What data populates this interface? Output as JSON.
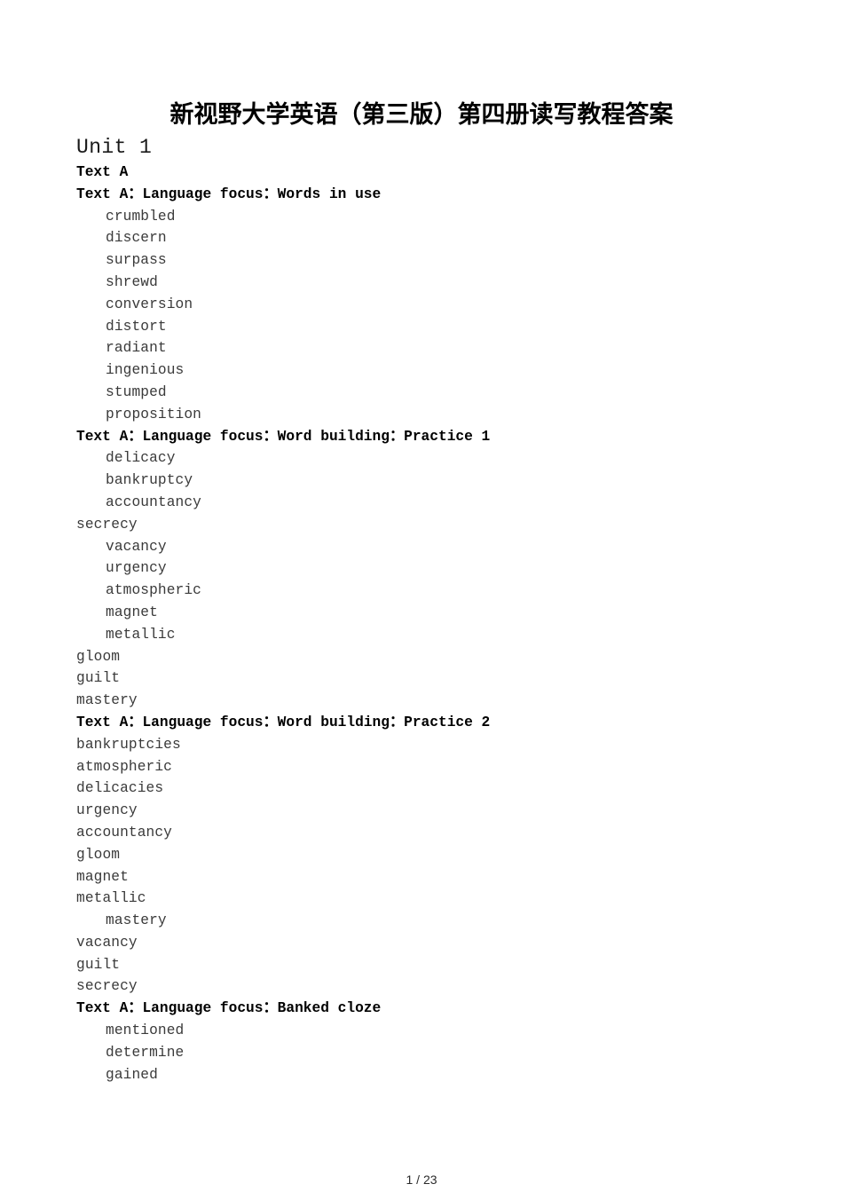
{
  "document": {
    "title": "新视野大学英语（第三版）第四册读写教程答案",
    "footer": "1 / 23"
  },
  "content": {
    "lines": [
      {
        "text": "Unit 1",
        "style": "unit",
        "indent": false
      },
      {
        "text": "Text A",
        "style": "heading",
        "indent": false
      },
      {
        "text": "Text A：Language focus：Words in use",
        "style": "heading",
        "indent": false
      },
      {
        "text": "crumbled",
        "style": "word",
        "indent": true
      },
      {
        "text": "discern",
        "style": "word",
        "indent": true
      },
      {
        "text": "surpass",
        "style": "word",
        "indent": true
      },
      {
        "text": "shrewd",
        "style": "word",
        "indent": true
      },
      {
        "text": "conversion",
        "style": "word",
        "indent": true
      },
      {
        "text": "distort",
        "style": "word",
        "indent": true
      },
      {
        "text": "radiant",
        "style": "word",
        "indent": true
      },
      {
        "text": "ingenious",
        "style": "word",
        "indent": true
      },
      {
        "text": "stumped",
        "style": "word",
        "indent": true
      },
      {
        "text": "proposition",
        "style": "word",
        "indent": true
      },
      {
        "text": "Text A：Language focus：Word building：Practice 1",
        "style": "heading",
        "indent": false
      },
      {
        "text": "delicacy",
        "style": "word",
        "indent": true
      },
      {
        "text": "bankruptcy",
        "style": "word",
        "indent": true
      },
      {
        "text": "accountancy",
        "style": "word",
        "indent": true
      },
      {
        "text": "secrecy",
        "style": "word",
        "indent": false
      },
      {
        "text": "vacancy",
        "style": "word",
        "indent": true
      },
      {
        "text": "urgency",
        "style": "word",
        "indent": true
      },
      {
        "text": "atmospheric",
        "style": "word",
        "indent": true
      },
      {
        "text": "magnet",
        "style": "word",
        "indent": true
      },
      {
        "text": "metallic",
        "style": "word",
        "indent": true
      },
      {
        "text": "gloom",
        "style": "word",
        "indent": false
      },
      {
        "text": "guilt",
        "style": "word",
        "indent": false
      },
      {
        "text": "mastery",
        "style": "word",
        "indent": false
      },
      {
        "text": "Text A：Language focus：Word building：Practice 2",
        "style": "heading",
        "indent": false
      },
      {
        "text": "bankruptcies",
        "style": "word",
        "indent": false
      },
      {
        "text": "atmospheric",
        "style": "word",
        "indent": false
      },
      {
        "text": "delicacies",
        "style": "word",
        "indent": false
      },
      {
        "text": "urgency",
        "style": "word",
        "indent": false
      },
      {
        "text": "accountancy",
        "style": "word",
        "indent": false
      },
      {
        "text": "gloom",
        "style": "word",
        "indent": false
      },
      {
        "text": "magnet",
        "style": "word",
        "indent": false
      },
      {
        "text": "metallic",
        "style": "word",
        "indent": false
      },
      {
        "text": "mastery",
        "style": "word",
        "indent": true
      },
      {
        "text": "vacancy",
        "style": "word",
        "indent": false
      },
      {
        "text": "guilt",
        "style": "word",
        "indent": false
      },
      {
        "text": "secrecy",
        "style": "word",
        "indent": false
      },
      {
        "text": "Text A：Language focus：Banked cloze",
        "style": "heading",
        "indent": false
      },
      {
        "text": "mentioned",
        "style": "word",
        "indent": true
      },
      {
        "text": "determine",
        "style": "word",
        "indent": true
      },
      {
        "text": "gained",
        "style": "word",
        "indent": true
      }
    ]
  }
}
